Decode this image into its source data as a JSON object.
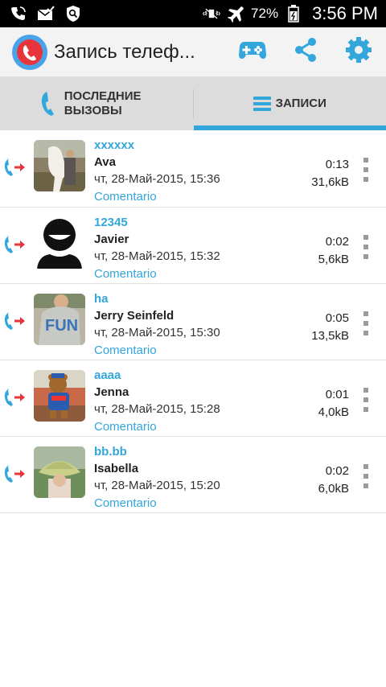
{
  "status_bar": {
    "icons_left": [
      "phone-call-icon",
      "mail-check-icon",
      "shield-search-icon"
    ],
    "icons_right": [
      "vibrate-off-icon",
      "airplane-mode-icon"
    ],
    "battery": "72%",
    "time": "3:56 PM"
  },
  "app_bar": {
    "title": "Запись телеф...",
    "actions": [
      "gamepad-icon",
      "share-icon",
      "settings-gear-icon"
    ]
  },
  "tabs": [
    {
      "label": "ПОСЛЕДНИЕ ВЫЗОВЫ",
      "icon": "phone-icon",
      "selected": false
    },
    {
      "label": "ЗАПИСИ",
      "icon": "list-icon",
      "selected": true
    }
  ],
  "recordings": [
    {
      "tag": "xxxxxx",
      "name": "Ava",
      "date": "чт, 28-Май-2015, 15:36",
      "duration": "0:13",
      "size": "31,6kB",
      "comment": "Comentario",
      "avatar": "photo-white-horse"
    },
    {
      "tag": "12345",
      "name": "Javier",
      "date": "чт, 28-Май-2015, 15:32",
      "duration": "0:02",
      "size": "5,6kB",
      "comment": "Comentario",
      "avatar": "default-contact-silhouette"
    },
    {
      "tag": "ha",
      "name": "Jerry Seinfeld",
      "date": "чт, 28-Май-2015, 15:30",
      "duration": "0:05",
      "size": "13,5kB",
      "comment": "Comentario",
      "avatar": "photo-child-fun-shirt"
    },
    {
      "tag": "aaaa",
      "name": "Jenna",
      "date": "чт, 28-Май-2015, 15:28",
      "duration": "0:01",
      "size": "4,0kB",
      "comment": "Comentario",
      "avatar": "photo-teddy-bear"
    },
    {
      "tag": "bb.bb",
      "name": "Isabella",
      "date": "чт, 28-Май-2015, 15:20",
      "duration": "0:02",
      "size": "6,0kB",
      "comment": "Comentario",
      "avatar": "photo-child-green-hat"
    }
  ],
  "colors": {
    "accent": "#33a6dc",
    "outgoing_arrow": "#e8353b",
    "tab_bar": "#dcdcdc",
    "app_bar": "#f3f3f3"
  }
}
